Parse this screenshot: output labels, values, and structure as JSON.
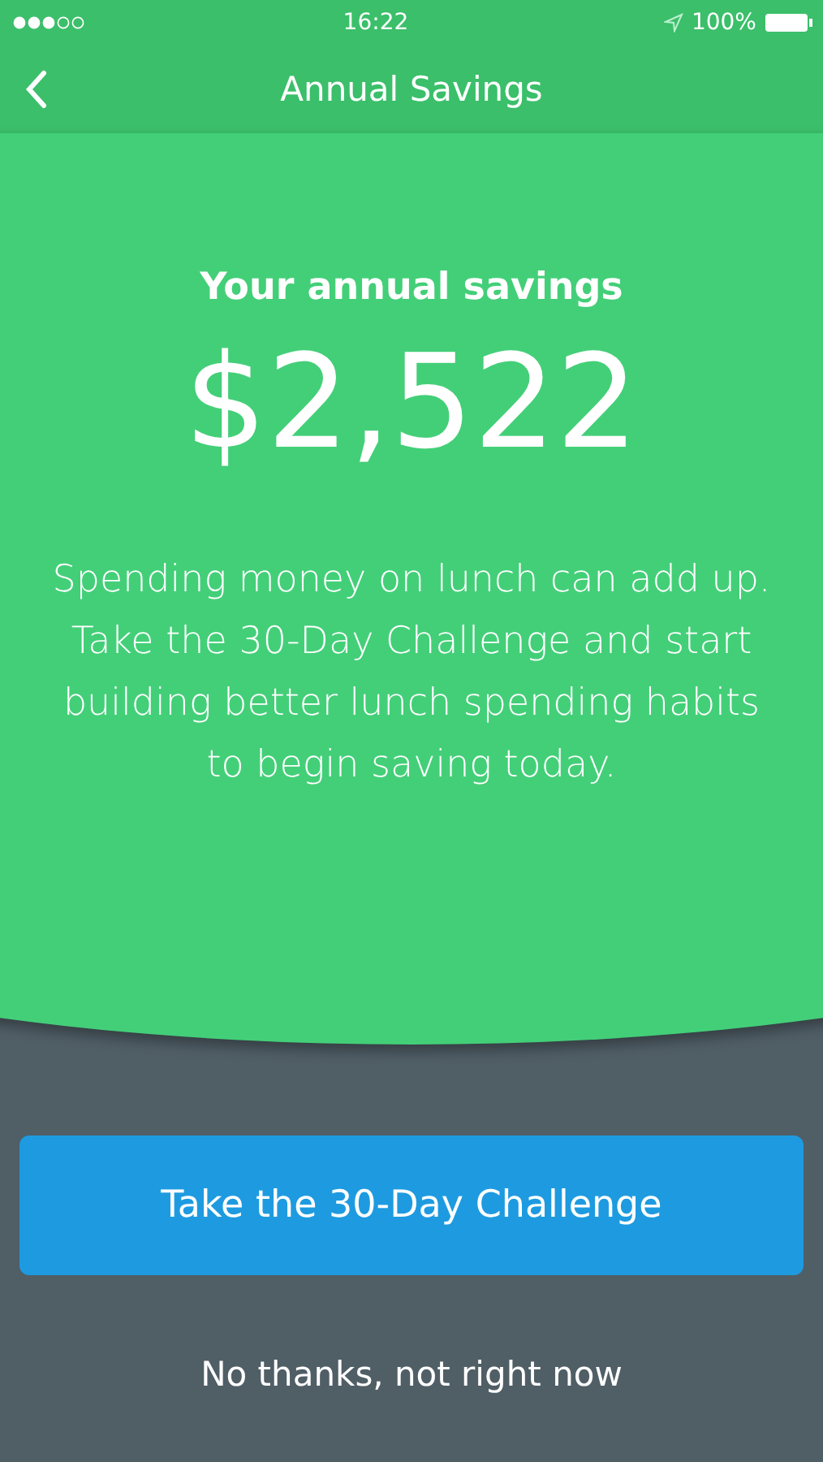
{
  "status_bar": {
    "time": "16:22",
    "battery": "100%"
  },
  "nav": {
    "title": "Annual Savings"
  },
  "summary": {
    "heading": "Your annual savings",
    "amount": "$2,522",
    "description": "Spending money on lunch can add up. Take the 30-Day Challenge and start building better lunch spending habits to begin saving today."
  },
  "buttons": [
    {
      "kind": "primary",
      "label": "Take the 30-Day Challenge"
    },
    {
      "kind": "link",
      "label": "No thanks, not right now"
    }
  ]
}
